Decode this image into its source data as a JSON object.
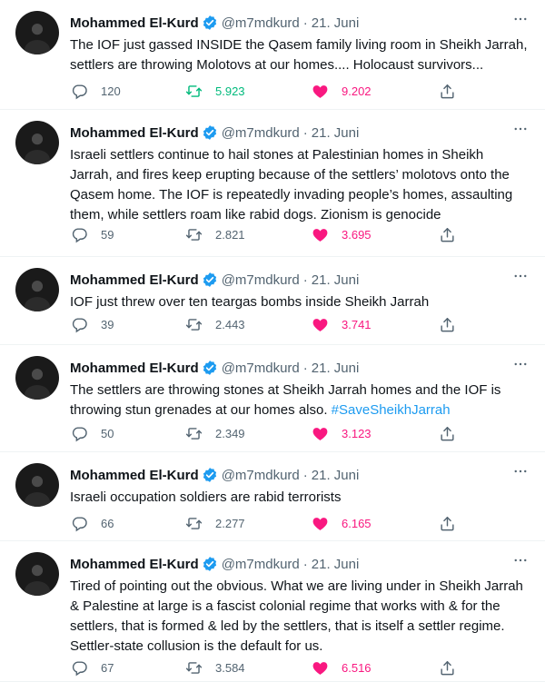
{
  "colors": {
    "like": "#f91880",
    "retweet_active": "#00ba7c",
    "link": "#1d9bf0",
    "muted": "#536471",
    "verified": "#1d9bf0"
  },
  "icons": {
    "reply": "speech-bubble-icon",
    "retweet": "retweet-arrows-icon",
    "like": "heart-filled-icon",
    "share": "share-upload-icon",
    "more": "more-dots-icon",
    "verified": "verified-badge-icon"
  },
  "tweets": [
    {
      "name": "Mohammed El-Kurd",
      "handle": "@m7mdkurd",
      "sep": "·",
      "date": "21. Juni",
      "more": "···",
      "text": "The IOF just gassed INSIDE the Qasem family living room in Sheikh Jarrah, settlers are throwing Molotovs at our homes.... Holocaust survivors...",
      "replies": "120",
      "retweets": "5.923",
      "likes": "9.202",
      "retweeted": true
    },
    {
      "name": "Mohammed El-Kurd",
      "handle": "@m7mdkurd",
      "sep": "·",
      "date": "21. Juni",
      "more": "···",
      "text": "Israeli settlers continue to hail stones at Palestinian homes in Sheikh Jarrah, and fires keep erupting because of the settlers’ molotovs onto the Qasem home. The IOF is repeatedly invading people’s homes, assaulting them, while settlers roam like rabid dogs. Zionism is genocide",
      "replies": "59",
      "retweets": "2.821",
      "likes": "3.695",
      "retweeted": false
    },
    {
      "name": "Mohammed El-Kurd",
      "handle": "@m7mdkurd",
      "sep": "·",
      "date": "21. Juni",
      "more": "···",
      "text": "IOF just threw over ten teargas bombs inside Sheikh Jarrah",
      "replies": "39",
      "retweets": "2.443",
      "likes": "3.741",
      "retweeted": false
    },
    {
      "name": "Mohammed El-Kurd",
      "handle": "@m7mdkurd",
      "sep": "·",
      "date": "21. Juni",
      "more": "···",
      "text": "The settlers are throwing stones at Sheikh Jarrah homes and the IOF is throwing stun grenades at our homes also. ",
      "hashtag": "#SaveSheikhJarrah",
      "replies": "50",
      "retweets": "2.349",
      "likes": "3.123",
      "retweeted": false
    },
    {
      "name": "Mohammed El-Kurd",
      "handle": "@m7mdkurd",
      "sep": "·",
      "date": "21. Juni",
      "more": "···",
      "text": "Israeli occupation soldiers are rabid terrorists",
      "replies": "66",
      "retweets": "2.277",
      "likes": "6.165",
      "retweeted": false
    },
    {
      "name": "Mohammed El-Kurd",
      "handle": "@m7mdkurd",
      "sep": "·",
      "date": "21. Juni",
      "more": "···",
      "text": "Tired of pointing out the obvious. What we are living under in Sheikh Jarrah & Palestine at large is a fascist colonial regime that works with & for the settlers, that is formed & led by the settlers, that is itself a settler regime. Settler-state collusion is the default for us.",
      "replies": "67",
      "retweets": "3.584",
      "likes": "6.516",
      "retweeted": false
    }
  ]
}
